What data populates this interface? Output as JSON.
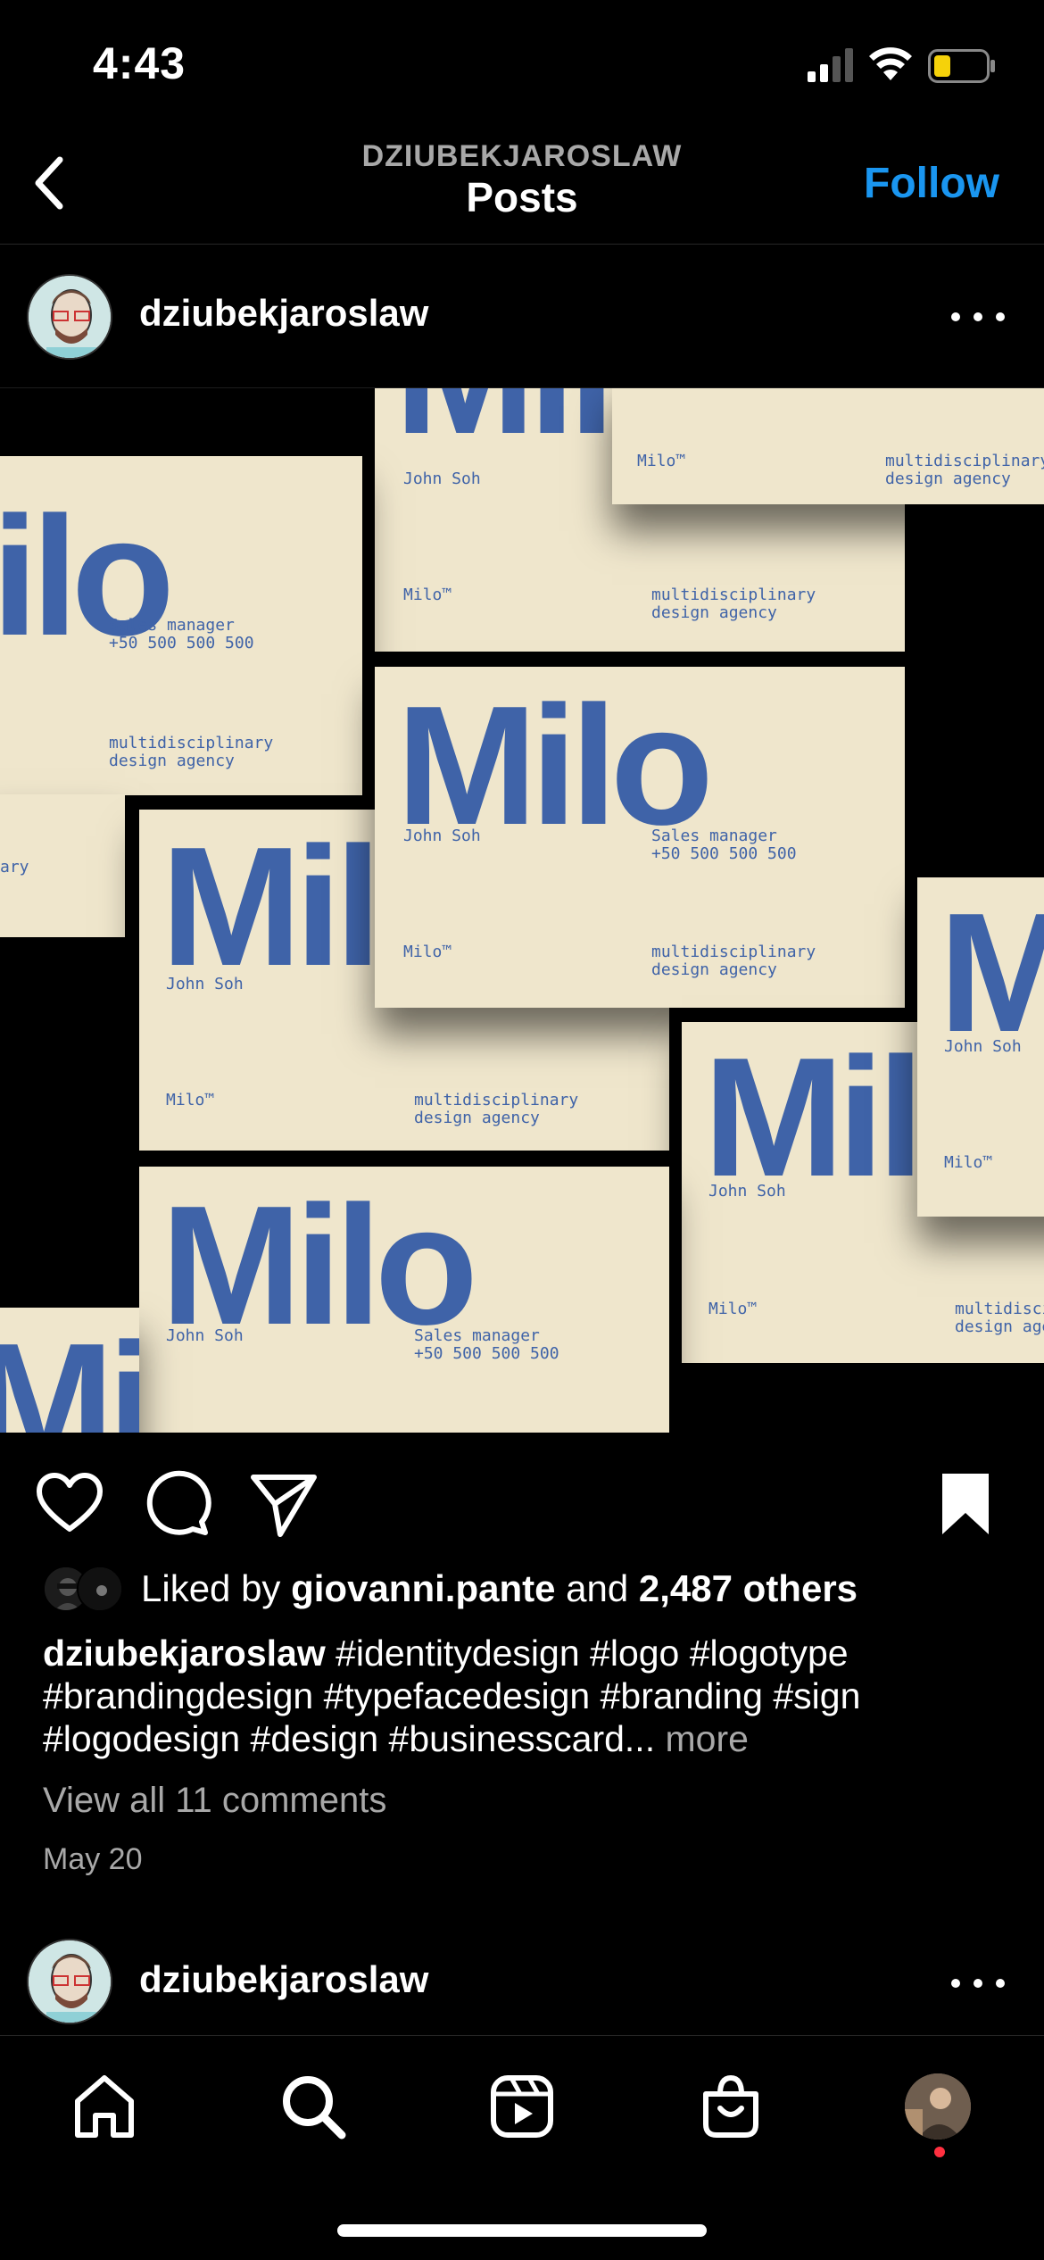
{
  "status_bar": {
    "time": "4:43"
  },
  "nav": {
    "username": "DZIUBEKJAROSLAW",
    "title": "Posts",
    "follow_label": "Follow"
  },
  "post": {
    "username": "dziubekjaroslaw",
    "image_text": {
      "brand": "Milo",
      "brand_tm": "Milo™",
      "name": "John Soh",
      "role": "Sales manager\n+50 500 500 500",
      "tagline": "multidisciplinary\ndesign agency",
      "tagline_fragment": "ary",
      "tagline_cut": "multidisci\ndesign age"
    },
    "likes": {
      "prefix": "Liked by ",
      "liker": "giovanni.pante",
      "and": " and ",
      "others": "2,487 others"
    },
    "caption": {
      "username": "dziubekjaroslaw",
      "text": " #identitydesign #logo #logotype #brandingdesign #typefacedesign #branding #sign #logodesign #design #businesscard...",
      "more": " more"
    },
    "comments_link": "View all 11 comments",
    "date": "May 20"
  },
  "next_post": {
    "username": "dziubekjaroslaw"
  },
  "colors": {
    "accent": "#1a96f0",
    "card": "#efe6cc",
    "ink": "#3f63a8"
  }
}
